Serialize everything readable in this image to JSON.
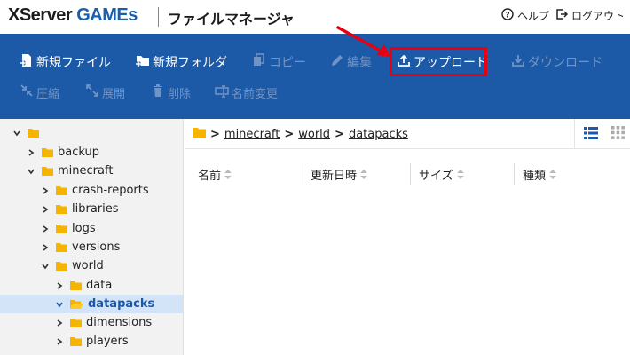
{
  "header": {
    "logo_x": "X",
    "logo_server": "Server ",
    "logo_games": "GAMEs",
    "app_title": "ファイルマネージャ",
    "help_label": "ヘルプ",
    "logout_label": "ログアウト"
  },
  "toolbar": {
    "new_file": "新規ファイル",
    "new_folder": "新規フォルダ",
    "copy": "コピー",
    "edit": "編集",
    "upload": "アップロード",
    "download": "ダウンロード",
    "compress": "圧縮",
    "extract": "展開",
    "delete": "削除",
    "rename": "名前変更"
  },
  "tree": {
    "backup": "backup",
    "minecraft": "minecraft",
    "crash_reports": "crash-reports",
    "libraries": "libraries",
    "logs": "logs",
    "versions": "versions",
    "world": "world",
    "data": "data",
    "datapacks": "datapacks",
    "dimensions": "dimensions",
    "players": "players"
  },
  "breadcrumb": {
    "items": [
      "minecraft",
      "world",
      "datapacks"
    ],
    "separator": ">"
  },
  "columns": {
    "name": "名前",
    "modified": "更新日時",
    "size": "サイズ",
    "type": "種類"
  },
  "colors": {
    "toolbar_bg": "#1c5aa8",
    "highlight": "#e60012",
    "folder": "#f5b400",
    "selected_bg": "#d3e4f8"
  }
}
